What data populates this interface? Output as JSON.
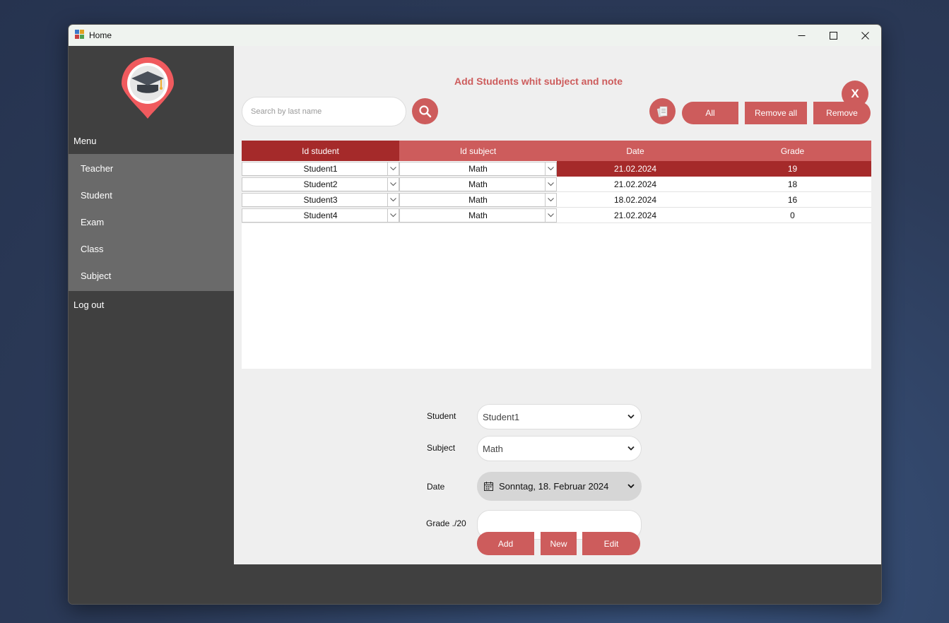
{
  "window": {
    "title": "Home"
  },
  "sidebar": {
    "menu_label": "Menu",
    "items": [
      {
        "label": "Teacher"
      },
      {
        "label": "Student"
      },
      {
        "label": "Exam"
      },
      {
        "label": "Class"
      },
      {
        "label": "Subject"
      }
    ],
    "logout_label": "Log out"
  },
  "main": {
    "title": "Add Students whit subject and note",
    "close_label": "X",
    "search": {
      "placeholder": "Search by last name",
      "value": ""
    },
    "buttons": {
      "all": "All",
      "remove_all": "Remove all",
      "remove": "Remove"
    }
  },
  "grid": {
    "columns": [
      "Id student",
      "Id subject",
      "Date",
      "Grade"
    ],
    "rows": [
      {
        "student": "Student1",
        "subject": "Math",
        "date": "21.02.2024",
        "grade": "19",
        "selected": true
      },
      {
        "student": "Student2",
        "subject": "Math",
        "date": "21.02.2024",
        "grade": "18",
        "selected": false
      },
      {
        "student": "Student3",
        "subject": "Math",
        "date": "18.02.2024",
        "grade": "16",
        "selected": false
      },
      {
        "student": "Student4",
        "subject": "Math",
        "date": "21.02.2024",
        "grade": "0",
        "selected": false
      }
    ]
  },
  "form": {
    "student_label": "Student",
    "student_value": "Student1",
    "subject_label": "Subject",
    "subject_value": "Math",
    "date_label": "Date",
    "date_value": "Sonntag, 18. Februar 2024",
    "grade_label": "Grade ./20",
    "grade_value": "",
    "add_label": "Add",
    "new_label": "New",
    "edit_label": "Edit"
  },
  "colors": {
    "accent": "#cd5c5c",
    "accent_dark": "#a52a2a",
    "sidebar": "#404040",
    "menu_panel": "#6a6a6a"
  }
}
